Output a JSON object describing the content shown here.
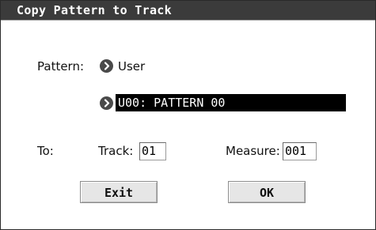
{
  "dialog": {
    "title": "Copy Pattern to Track"
  },
  "pattern": {
    "label": "Pattern:",
    "bank_value": "User",
    "selected_pattern": "U00: PATTERN 00"
  },
  "destination": {
    "to_label": "To:",
    "track_label": "Track:",
    "track_value": "01",
    "measure_label": "Measure:",
    "measure_value": "001"
  },
  "buttons": {
    "exit_label": "Exit",
    "ok_label": "OK"
  },
  "colors": {
    "titlebar": "#3b3b3b",
    "popup_icon": "#4a4a4a",
    "selected_field": "#000000"
  },
  "icons": {
    "popup": "chevron-right-circle-icon"
  }
}
